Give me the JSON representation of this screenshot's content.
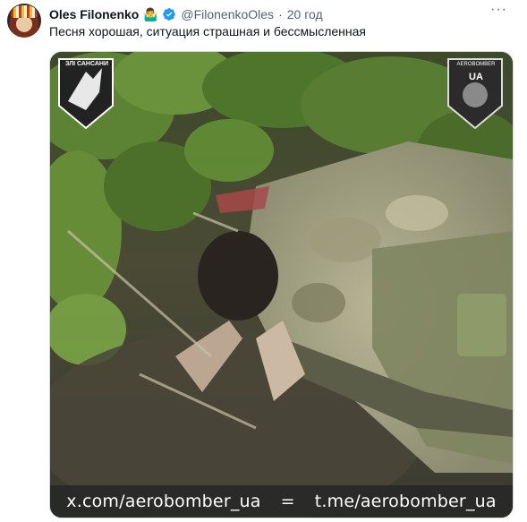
{
  "author": {
    "name": "Oles Filonenko",
    "emoji": "🤷‍♂️",
    "handle": "@FilonenkoOles",
    "separator": "·",
    "timestamp": "20 год"
  },
  "tweet": {
    "text": "Песня хорошая, ситуация страшная и бессмысленная"
  },
  "media": {
    "logo_left_text": "ЗЛІ САНСАНИ",
    "logo_right_text_top": "AEROBOMBER",
    "logo_right_text_main": "UA",
    "watermark_left": "x.com/aerobomber_ua",
    "watermark_sep": "=",
    "watermark_right": "t.me/aerobomber_ua"
  },
  "colors": {
    "verified": "#1d9bf0",
    "text_primary": "#0f1419",
    "text_secondary": "#536471",
    "border": "#cfd9de"
  },
  "icons": {
    "verified": "verified-badge-icon",
    "more": "more-horizontal-icon"
  }
}
